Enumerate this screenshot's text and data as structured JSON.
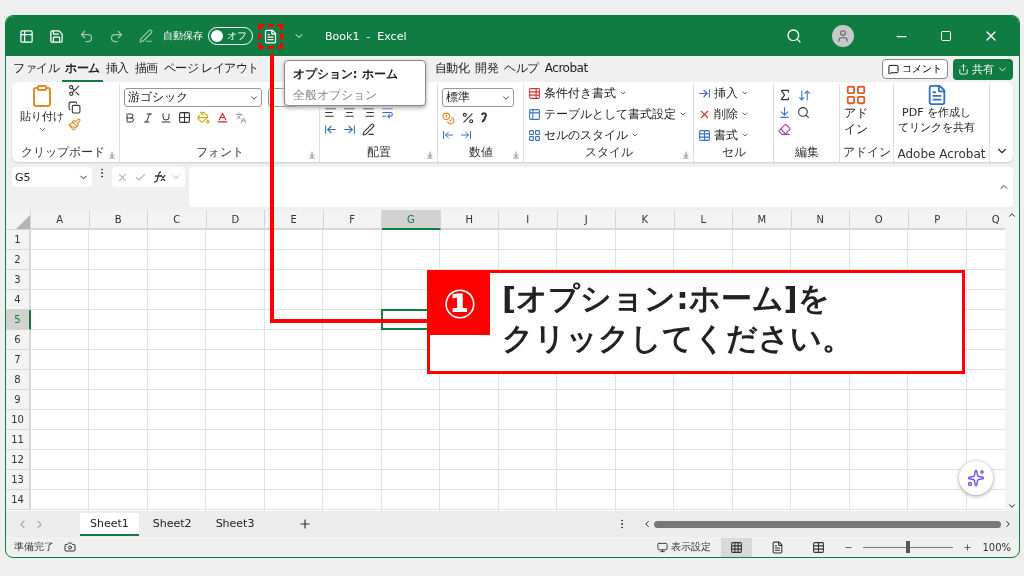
{
  "title_bar": {
    "autosave_label": "自動保存",
    "autosave_state": "オフ",
    "autosave_on": false,
    "options_highlighted": true,
    "title": "Book1  -  Excel"
  },
  "tooltip": {
    "title": "オプション: ホーム",
    "description": "全般オプション"
  },
  "tabs": [
    {
      "label": "ファイル",
      "selected": false
    },
    {
      "label": "ホーム",
      "selected": true
    },
    {
      "label": "挿入",
      "selected": false
    },
    {
      "label": "描画",
      "selected": false
    },
    {
      "label": "ページ レイアウト",
      "selected": false
    },
    {
      "label": "自動化",
      "selected": false
    },
    {
      "label": "開発",
      "selected": false
    },
    {
      "label": "ヘルプ",
      "selected": false
    },
    {
      "label": "Acrobat",
      "selected": false
    }
  ],
  "comment_button": "コメント",
  "share_button": "共有",
  "ribbon": {
    "clipboard": {
      "label": "クリップボード",
      "paste": "貼り付け"
    },
    "font": {
      "label": "フォント",
      "font_name": "游ゴシック"
    },
    "alignment": {
      "label": "配置"
    },
    "number": {
      "label": "数値",
      "format": "標準"
    },
    "styles": {
      "label": "スタイル",
      "items": [
        "条件付き書式",
        "テーブルとして書式設定",
        "セルのスタイル"
      ]
    },
    "cells": {
      "label": "セル",
      "items": [
        "挿入",
        "削除",
        "書式"
      ]
    },
    "editing": {
      "label": "編集"
    },
    "addins": {
      "label": "アドイン",
      "button": "アドイン"
    },
    "acrobat": {
      "label": "Adobe Acrobat",
      "button_lines": [
        "PDF を作成し",
        "てリンクを共有"
      ]
    }
  },
  "formula_bar": {
    "name_box": "G5"
  },
  "columns": [
    {
      "label": "A",
      "selected": false
    },
    {
      "label": "B",
      "selected": false
    },
    {
      "label": "C",
      "selected": false
    },
    {
      "label": "D",
      "selected": false
    },
    {
      "label": "E",
      "selected": false
    },
    {
      "label": "F",
      "selected": false
    },
    {
      "label": "G",
      "selected": true
    },
    {
      "label": "H",
      "selected": false
    },
    {
      "label": "I",
      "selected": false
    },
    {
      "label": "J",
      "selected": false
    },
    {
      "label": "K",
      "selected": false
    },
    {
      "label": "L",
      "selected": false
    },
    {
      "label": "M",
      "selected": false
    },
    {
      "label": "N",
      "selected": false
    },
    {
      "label": "O",
      "selected": false
    },
    {
      "label": "P",
      "selected": false
    },
    {
      "label": "Q",
      "selected": false
    }
  ],
  "rows": [
    {
      "label": "1",
      "selected": false
    },
    {
      "label": "2",
      "selected": false
    },
    {
      "label": "3",
      "selected": false
    },
    {
      "label": "4",
      "selected": false
    },
    {
      "label": "5",
      "selected": true
    },
    {
      "label": "6",
      "selected": false
    },
    {
      "label": "7",
      "selected": false
    },
    {
      "label": "8",
      "selected": false
    },
    {
      "label": "9",
      "selected": false
    },
    {
      "label": "10",
      "selected": false
    },
    {
      "label": "11",
      "selected": false
    },
    {
      "label": "12",
      "selected": false
    },
    {
      "label": "13",
      "selected": false
    },
    {
      "label": "14",
      "selected": false
    }
  ],
  "sheets": [
    {
      "label": "Sheet1",
      "selected": true
    },
    {
      "label": "Sheet2",
      "selected": false
    },
    {
      "label": "Sheet3",
      "selected": false
    }
  ],
  "status_bar": {
    "status": "準備完了",
    "display_settings": "表示設定",
    "views": [
      {
        "kind": "normal",
        "selected": true
      },
      {
        "kind": "layout",
        "selected": false
      },
      {
        "kind": "pagebreak",
        "selected": false
      }
    ],
    "zoom": {
      "level": 0.5,
      "label": "100%"
    }
  },
  "callout": {
    "number": "①",
    "lines": [
      "[オプション:ホーム]を",
      "クリックしてください。"
    ]
  }
}
